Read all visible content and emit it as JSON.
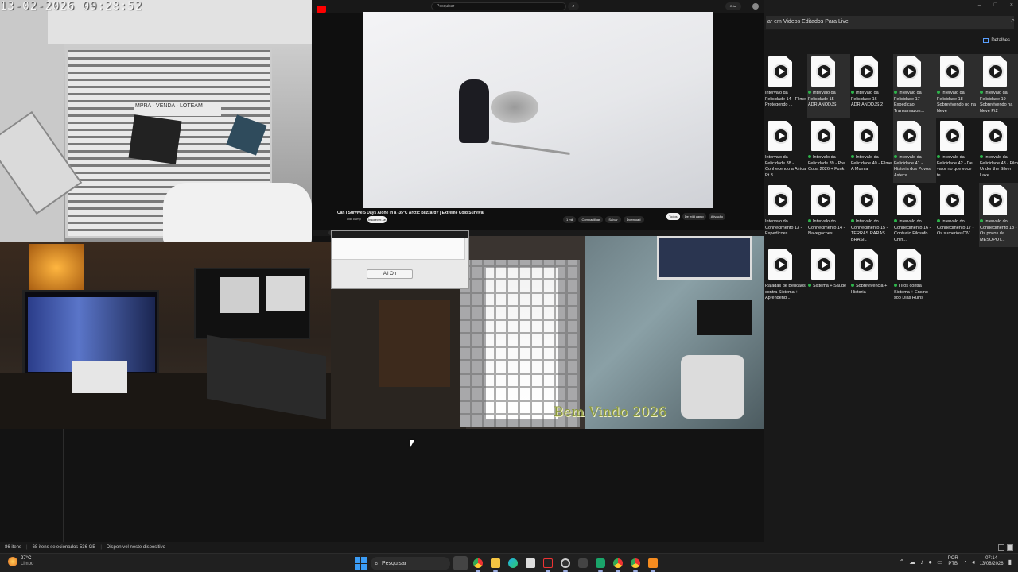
{
  "camera": {
    "timestamp": "13-02-2026 09:28:52",
    "sign_text": "MPRA · VENDA · LOTEAM"
  },
  "youtube": {
    "search_placeholder": "Pesquisar",
    "create_label": "Criar",
    "video_title": "Can I Survive 5 Days Alone in a -35°C Arctic Blizzard? | Extreme Cold Survival",
    "channel": "wild camp",
    "subscribe_label": "Inscrever-se",
    "actions": [
      "1 mil",
      "Compartilhar",
      "Salvar",
      "Download"
    ],
    "chips": [
      {
        "label": "Todos",
        "active": true
      },
      {
        "label": "De wild camp",
        "active": false
      },
      {
        "label": "Ativação",
        "active": false
      }
    ]
  },
  "dialog": {
    "all_on_label": "All On"
  },
  "hall_cam": {
    "overlay_text": "Bem Vindo 2026"
  },
  "explorer": {
    "search_text": "ar em Videos Editados Para Live",
    "details_label": "Detalhes",
    "window_buttons": [
      "–",
      "□",
      "×"
    ],
    "files": [
      {
        "label": "Intervalo da Felicidade 14 - Filme Protegendo ...",
        "synced": false,
        "selected": false
      },
      {
        "label": "Intervalo da Felicidade 15 - ADRIANODJS",
        "synced": true,
        "selected": true
      },
      {
        "label": "Intervalo da Felicidade 16 - ADRIANODJS 2",
        "synced": true,
        "selected": false
      },
      {
        "label": "Intervalo da Felicidade 17 - Expedicao Transamazon...",
        "synced": true,
        "selected": true
      },
      {
        "label": "Intervalo da Felicidade 18 - Sobrevivendo no na Neve",
        "synced": true,
        "selected": true
      },
      {
        "label": "Intervalo da Felicidade 19 - Sobrevivendo na Neve Pt2",
        "synced": true,
        "selected": true
      },
      {
        "label": "Intervalo da Felicidade 38 - Conhecendo a Africa Pt 3",
        "synced": false,
        "selected": false
      },
      {
        "label": "Intervalo da Felicidade 39 - Pre Copa 2026 + Funk",
        "synced": true,
        "selected": false
      },
      {
        "label": "Intervalo da Felicidade 40 - Filme A Mumia",
        "synced": true,
        "selected": false
      },
      {
        "label": "Intervalo da Felicidade 41 - Historia dos Povos Asteca...",
        "synced": true,
        "selected": true
      },
      {
        "label": "Intervalo da Felicidade 42 - De valor no que voce te...",
        "synced": true,
        "selected": false
      },
      {
        "label": "Intervalo da Felicidade 43 - Filme Under the Silver Lake",
        "synced": true,
        "selected": false
      },
      {
        "label": "Intervalo do Conhecimento 13 - Expedicoes ...",
        "synced": false,
        "selected": false
      },
      {
        "label": "Intervalo do Conhecimento 14 - Navegacoes ...",
        "synced": true,
        "selected": false
      },
      {
        "label": "Intervalo do Conhecimento 15 - TERRAS RARAS BRASIL",
        "synced": true,
        "selected": false
      },
      {
        "label": "Intervalo do Conhecimento 16 - Confucio Filosofo Chin...",
        "synced": true,
        "selected": false
      },
      {
        "label": "Intervalo do Conhecimento 17 - Os sumerios CIV...",
        "synced": true,
        "selected": false
      },
      {
        "label": "Intervalo do Conhecimento 18 - Os povos da MESOPOT...",
        "synced": true,
        "selected": true
      },
      {
        "label": "Rajadas de Bencaos contra Sistema + Aprendend...",
        "synced": false,
        "selected": false
      },
      {
        "label": "Sistema + Saude",
        "synced": true,
        "selected": false
      },
      {
        "label": "Sobrevivencia + Historia",
        "synced": true,
        "selected": false
      },
      {
        "label": "Tiros contra Sistema + Ensino sob Dias Ruins",
        "synced": true,
        "selected": false
      }
    ],
    "status": [
      "86 itens",
      "68 itens selecionados  536 GB",
      "Disponível neste dispositivo"
    ]
  },
  "taskbar": {
    "weather_temp": "27°C",
    "weather_desc": "Limpo",
    "search_label": "Pesquisar",
    "lang_top": "POR",
    "lang_bottom": "PTB",
    "time": "07:14",
    "date": "13/08/2026"
  },
  "colors": {
    "accent": "#3b9cf5",
    "sync_green": "#2db34a",
    "youtube_red": "#ff0000"
  }
}
